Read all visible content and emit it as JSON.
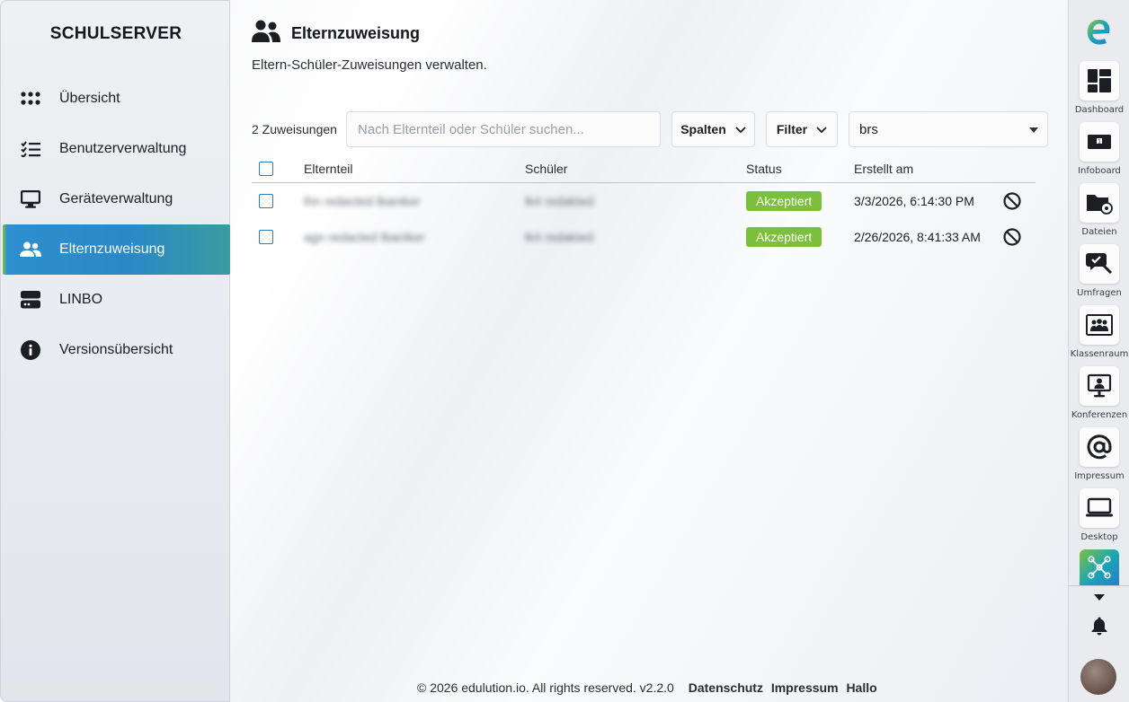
{
  "sidebar": {
    "brand": "SCHULSERVER",
    "items": [
      {
        "label": "Übersicht",
        "icon": "grid-dots-icon"
      },
      {
        "label": "Benutzerverwaltung",
        "icon": "checklist-icon"
      },
      {
        "label": "Geräteverwaltung",
        "icon": "monitor-icon"
      },
      {
        "label": "Elternzuweisung",
        "icon": "users-icon",
        "active": true
      },
      {
        "label": "LINBO",
        "icon": "server-icon"
      },
      {
        "label": "Versionsübersicht",
        "icon": "info-icon"
      }
    ]
  },
  "header": {
    "title": "Elternzuweisung",
    "subtitle": "Eltern-Schüler-Zuweisungen verwalten."
  },
  "toolbar": {
    "count": "2 Zuweisungen",
    "search_placeholder": "Nach Elternteil oder Schüler suchen...",
    "columns_label": "Spalten",
    "filter_label": "Filter",
    "selected_value": "brs"
  },
  "table": {
    "headers": {
      "parent": "Elternteil",
      "student": "Schüler",
      "status": "Status",
      "created": "Erstellt am"
    },
    "rows": [
      {
        "parent": "lhn redacted lbaniker",
        "student": "lk4 redakted",
        "status": "Akzeptiert",
        "created": "3/3/2026, 6:14:30 PM"
      },
      {
        "parent": "agn redacted lbaniker",
        "student": "lk4 redakted",
        "status": "Akzeptiert",
        "created": "2/26/2026, 8:41:33 AM"
      }
    ]
  },
  "footer": {
    "copyright": "© 2026 edulution.io. All rights reserved. v2.2.0",
    "privacy": "Datenschutz",
    "imprint": "Impressum",
    "hello": "Hallo"
  },
  "rail": {
    "items": [
      {
        "label": "Dashboard",
        "icon": "dashboard-icon"
      },
      {
        "label": "Infoboard",
        "icon": "infoboard-icon"
      },
      {
        "label": "Dateien",
        "icon": "folder-share-icon"
      },
      {
        "label": "Umfragen",
        "icon": "survey-icon"
      },
      {
        "label": "Klassenraum",
        "icon": "classroom-icon"
      },
      {
        "label": "Konferenzen",
        "icon": "conference-icon"
      },
      {
        "label": "Impressum",
        "icon": "at-sign-icon"
      },
      {
        "label": "Desktop",
        "icon": "laptop-icon"
      }
    ]
  },
  "colors": {
    "accent_blue": "#2a88c8",
    "accent_green": "#7cc242",
    "badge_green": "#7bbf3a"
  }
}
